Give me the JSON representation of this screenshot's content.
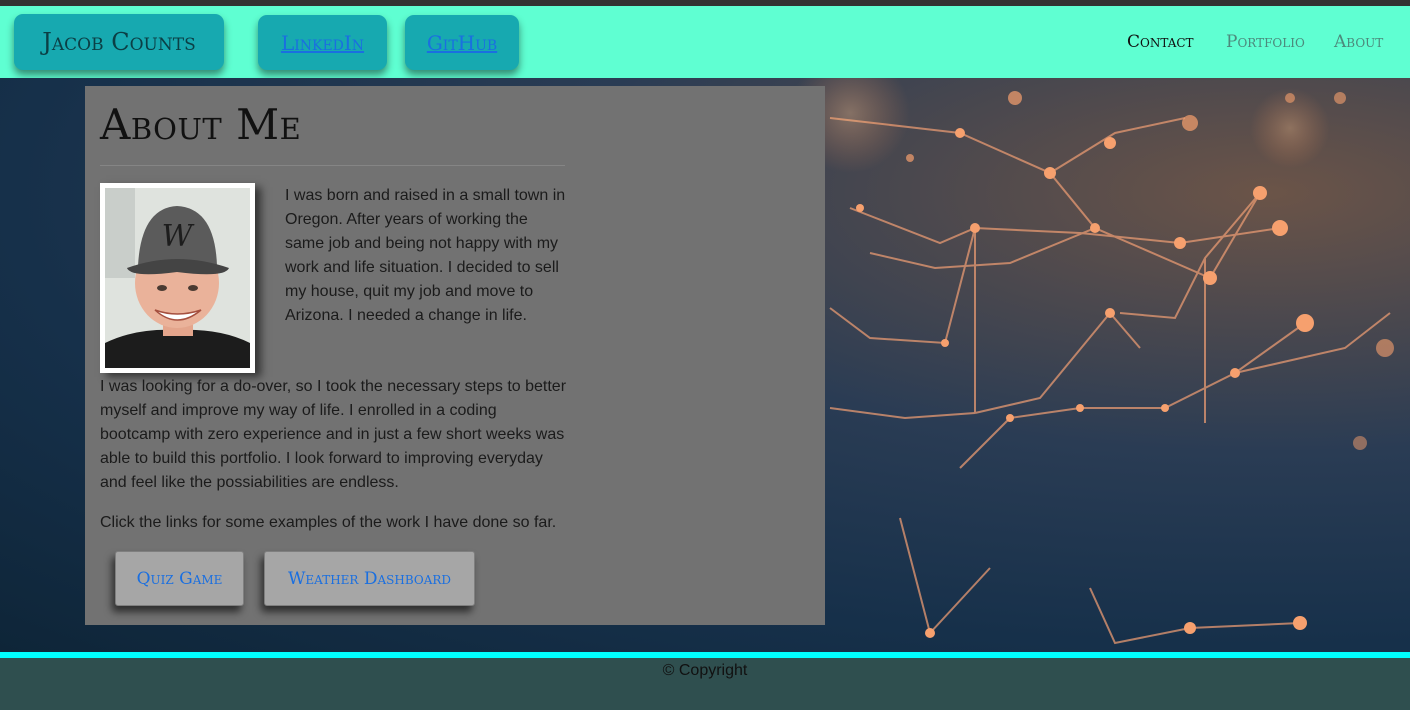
{
  "nav": {
    "brand": "Jacob Counts",
    "linkedin": "LinkedIn",
    "github": "GitHub",
    "menu": [
      "Contact",
      "Portfolio",
      "About"
    ]
  },
  "about": {
    "heading": "About Me",
    "intro": "I was born and raised in a small town in Oregon. After years of working the same job and being not happy with my work and life situation. I decided to sell my house, quit my job and move to Arizona. I needed a change in life.",
    "story": "I was looking for a do-over, so I took the necessary steps to better myself and improve my way of life. I enrolled in a coding bootcamp with zero experience and in just a few short weeks was able to build this portfolio. I look forward to improving everyday and feel like the possiabilities are endless.",
    "cta": "Click the links for some examples of the work I have done so far.",
    "projects": [
      "Quiz Game",
      "Weather Dashboard"
    ]
  },
  "footer": {
    "copyright": "© Copyright"
  },
  "colors": {
    "navbar": "#5fffd2",
    "button": "#17a9b0",
    "panel": "#727272",
    "footer_line": "#00ffff",
    "footer": "#2f4f4f",
    "link": "#1a6fe0"
  },
  "icons": {
    "photo": "profile-photo"
  }
}
